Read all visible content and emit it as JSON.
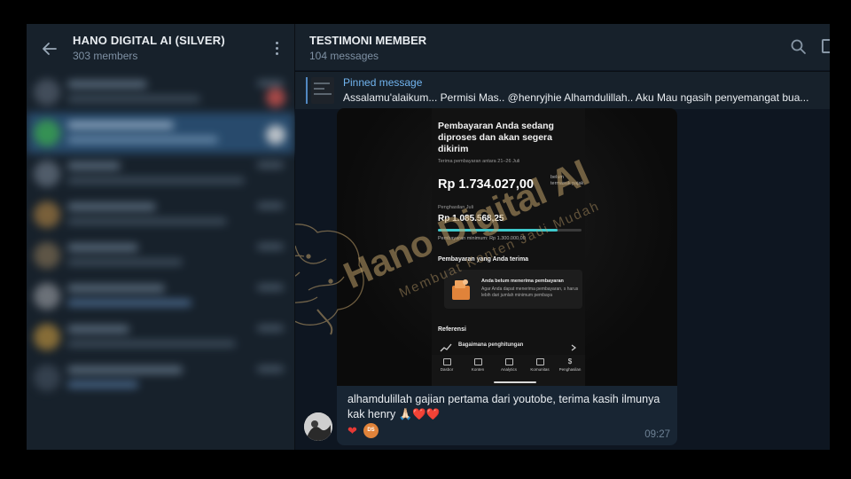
{
  "left_panel": {
    "back_icon": "arrow-left-icon",
    "title": "HANO DIGITAL AI (SILVER)",
    "subtitle": "303 members",
    "menu_icon": "kebab-menu-icon"
  },
  "chat": {
    "title": "TESTIMONI MEMBER",
    "subtitle": "104 messages",
    "search_icon": "search-icon"
  },
  "pinned": {
    "label": "Pinned message",
    "text": "Assalamu'alaikum... Permisi Mas.. @henryjhie  Alhamdulillah.. Aku Mau ngasih penyemangat bua..."
  },
  "screenshot": {
    "title": "Pembayaran Anda sedang diproses dan akan segera dikirim",
    "range": "Terima pembayaran antara 21–26 Juli",
    "amount": "Rp 1.734.027,00",
    "amount_note": "belum termasuk pajak",
    "earn_label": "Penghasilan Juli",
    "earn": "Rp 1.085.568,25",
    "progress_fraction": 0.835,
    "minimum": "Pembayaran minimum: Rp 1.300.000,00",
    "received_heading": "Pembayaran yang Anda terima",
    "card_title": "Anda belum menerima pembayaran",
    "card_body": "Agar Anda dapat menerima pembayaran, s harus lebih dari jumlah minimum pembaya",
    "ref_heading": "Referensi",
    "ref_item": "Bagaimana penghitungan",
    "nav": [
      "Dasbor",
      "Konten",
      "Analytics",
      "Komunitas",
      "Penghasilan"
    ]
  },
  "watermark": {
    "brand": "Hano Digital AI",
    "tagline": "Membuat Konten Jadi Mudah"
  },
  "message": {
    "caption": "alhamdulillah gajian pertama dari youtobe, terima kasih ilmunya kak henry 🙏🏻❤️❤️",
    "reaction_avatar": "DS",
    "time": "09:27"
  },
  "colors": {
    "accent": "#5288c1",
    "pinned_label": "#71b4ef",
    "progress": "#3ec9cc",
    "heart": "#e53935",
    "watermark": "#c0a06a"
  }
}
